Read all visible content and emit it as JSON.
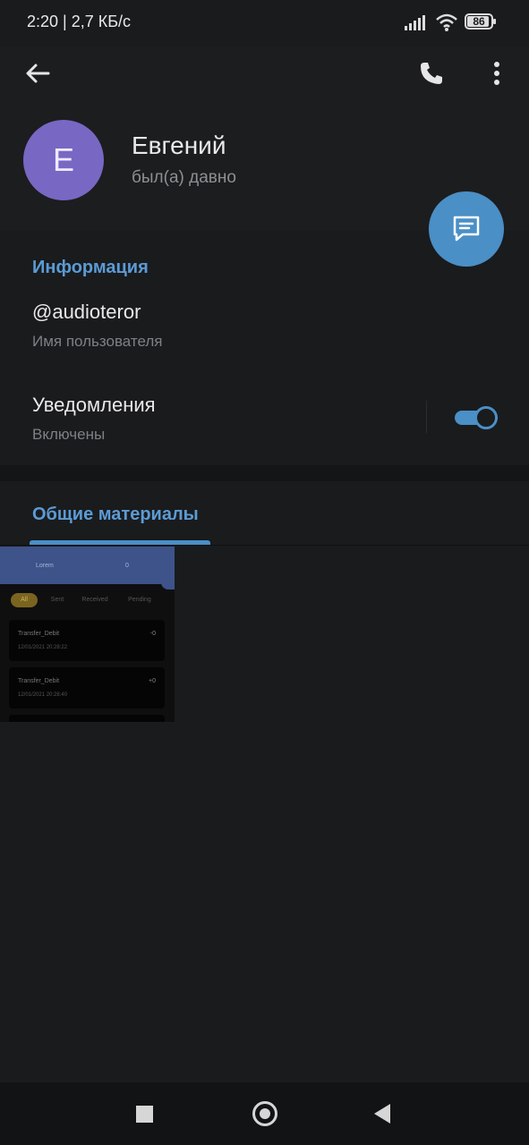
{
  "status_bar": {
    "left_text": "2:20 | 2,7 КБ/с",
    "battery": "86",
    "icons": [
      "signal-icon",
      "wifi-icon",
      "battery-icon"
    ]
  },
  "header": {
    "icons": [
      "back-arrow-icon",
      "phone-icon",
      "more-vertical-icon"
    ],
    "avatar_letter": "Е",
    "name": "Евгений",
    "status": "был(а) давно",
    "fab_icon": "message-icon"
  },
  "info": {
    "title": "Информация",
    "username": "@audioteror",
    "username_label": "Имя пользователя",
    "notifications_label": "Уведомления",
    "notifications_status": "Включены",
    "notifications_enabled": true
  },
  "shared": {
    "tab_label": "Общие материалы",
    "thumbnail": {
      "header_text": "Lorem",
      "header_num": "0",
      "chips": [
        "All",
        "Sent",
        "Received",
        "Pending"
      ],
      "cards": [
        {
          "title": "Transfer_Debit",
          "date": "12/01/2021 20:28:22",
          "value": "-0"
        },
        {
          "title": "Transfer_Debit",
          "date": "12/01/2021 20:28:40",
          "value": "+0"
        }
      ]
    }
  },
  "nav": {
    "icons": [
      "recents-square-icon",
      "home-circle-icon",
      "back-triangle-icon"
    ]
  },
  "colors": {
    "accent": "#4a8fc6",
    "avatar": "#7967c4",
    "background": "#1a1b1d"
  }
}
